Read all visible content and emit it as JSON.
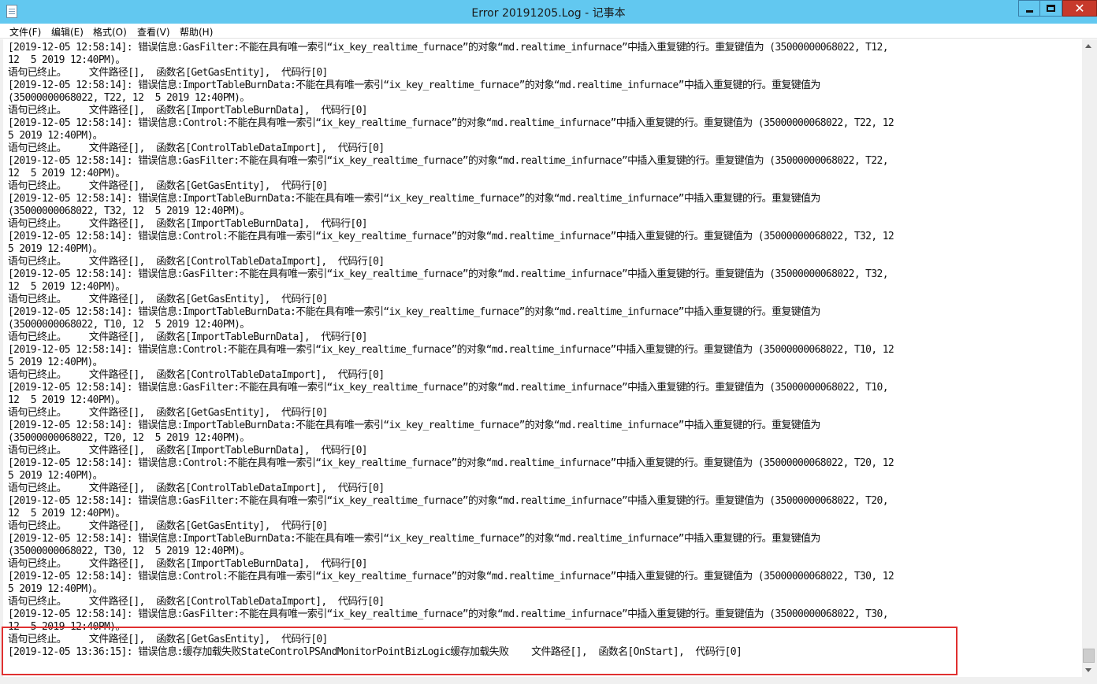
{
  "window": {
    "title": "Error 20191205.Log - 记事本"
  },
  "menu": [
    "文件(F)",
    "编辑(E)",
    "格式(O)",
    "查看(V)",
    "帮助(H)"
  ],
  "log_lines": [
    "[2019-12-05 12:58:14]: 错误信息:GasFilter:不能在具有唯一索引“ix_key_realtime_furnace”的对象“md.realtime_infurnace”中插入重复键的行。重复键值为 (35000000068022, T12,",
    "12  5 2019 12:40PM)。",
    "语句已终止。    文件路径[],  函数名[GetGasEntity],  代码行[0]",
    "[2019-12-05 12:58:14]: 错误信息:ImportTableBurnData:不能在具有唯一索引“ix_key_realtime_furnace”的对象“md.realtime_infurnace”中插入重复键的行。重复键值为",
    "(35000000068022, T22, 12  5 2019 12:40PM)。",
    "语句已终止。    文件路径[],  函数名[ImportTableBurnData],  代码行[0]",
    "[2019-12-05 12:58:14]: 错误信息:Control:不能在具有唯一索引“ix_key_realtime_furnace”的对象“md.realtime_infurnace”中插入重复键的行。重复键值为 (35000000068022, T22, 12",
    "5 2019 12:40PM)。",
    "语句已终止。    文件路径[],  函数名[ControlTableDataImport],  代码行[0]",
    "[2019-12-05 12:58:14]: 错误信息:GasFilter:不能在具有唯一索引“ix_key_realtime_furnace”的对象“md.realtime_infurnace”中插入重复键的行。重复键值为 (35000000068022, T22,",
    "12  5 2019 12:40PM)。",
    "语句已终止。    文件路径[],  函数名[GetGasEntity],  代码行[0]",
    "[2019-12-05 12:58:14]: 错误信息:ImportTableBurnData:不能在具有唯一索引“ix_key_realtime_furnace”的对象“md.realtime_infurnace”中插入重复键的行。重复键值为",
    "(35000000068022, T32, 12  5 2019 12:40PM)。",
    "语句已终止。    文件路径[],  函数名[ImportTableBurnData],  代码行[0]",
    "[2019-12-05 12:58:14]: 错误信息:Control:不能在具有唯一索引“ix_key_realtime_furnace”的对象“md.realtime_infurnace”中插入重复键的行。重复键值为 (35000000068022, T32, 12",
    "5 2019 12:40PM)。",
    "语句已终止。    文件路径[],  函数名[ControlTableDataImport],  代码行[0]",
    "[2019-12-05 12:58:14]: 错误信息:GasFilter:不能在具有唯一索引“ix_key_realtime_furnace”的对象“md.realtime_infurnace”中插入重复键的行。重复键值为 (35000000068022, T32,",
    "12  5 2019 12:40PM)。",
    "语句已终止。    文件路径[],  函数名[GetGasEntity],  代码行[0]",
    "[2019-12-05 12:58:14]: 错误信息:ImportTableBurnData:不能在具有唯一索引“ix_key_realtime_furnace”的对象“md.realtime_infurnace”中插入重复键的行。重复键值为",
    "(35000000068022, T10, 12  5 2019 12:40PM)。",
    "语句已终止。    文件路径[],  函数名[ImportTableBurnData],  代码行[0]",
    "[2019-12-05 12:58:14]: 错误信息:Control:不能在具有唯一索引“ix_key_realtime_furnace”的对象“md.realtime_infurnace”中插入重复键的行。重复键值为 (35000000068022, T10, 12",
    "5 2019 12:40PM)。",
    "语句已终止。    文件路径[],  函数名[ControlTableDataImport],  代码行[0]",
    "[2019-12-05 12:58:14]: 错误信息:GasFilter:不能在具有唯一索引“ix_key_realtime_furnace”的对象“md.realtime_infurnace”中插入重复键的行。重复键值为 (35000000068022, T10,",
    "12  5 2019 12:40PM)。",
    "语句已终止。    文件路径[],  函数名[GetGasEntity],  代码行[0]",
    "[2019-12-05 12:58:14]: 错误信息:ImportTableBurnData:不能在具有唯一索引“ix_key_realtime_furnace”的对象“md.realtime_infurnace”中插入重复键的行。重复键值为",
    "(35000000068022, T20, 12  5 2019 12:40PM)。",
    "语句已终止。    文件路径[],  函数名[ImportTableBurnData],  代码行[0]",
    "[2019-12-05 12:58:14]: 错误信息:Control:不能在具有唯一索引“ix_key_realtime_furnace”的对象“md.realtime_infurnace”中插入重复键的行。重复键值为 (35000000068022, T20, 12",
    "5 2019 12:40PM)。",
    "语句已终止。    文件路径[],  函数名[ControlTableDataImport],  代码行[0]",
    "[2019-12-05 12:58:14]: 错误信息:GasFilter:不能在具有唯一索引“ix_key_realtime_furnace”的对象“md.realtime_infurnace”中插入重复键的行。重复键值为 (35000000068022, T20,",
    "12  5 2019 12:40PM)。",
    "语句已终止。    文件路径[],  函数名[GetGasEntity],  代码行[0]",
    "[2019-12-05 12:58:14]: 错误信息:ImportTableBurnData:不能在具有唯一索引“ix_key_realtime_furnace”的对象“md.realtime_infurnace”中插入重复键的行。重复键值为",
    "(35000000068022, T30, 12  5 2019 12:40PM)。",
    "语句已终止。    文件路径[],  函数名[ImportTableBurnData],  代码行[0]",
    "[2019-12-05 12:58:14]: 错误信息:Control:不能在具有唯一索引“ix_key_realtime_furnace”的对象“md.realtime_infurnace”中插入重复键的行。重复键值为 (35000000068022, T30, 12",
    "5 2019 12:40PM)。",
    "语句已终止。    文件路径[],  函数名[ControlTableDataImport],  代码行[0]",
    "[2019-12-05 12:58:14]: 错误信息:GasFilter:不能在具有唯一索引“ix_key_realtime_furnace”的对象“md.realtime_infurnace”中插入重复键的行。重复键值为 (35000000068022, T30,",
    "12  5 2019 12:40PM)。",
    "语句已终止。    文件路径[],  函数名[GetGasEntity],  代码行[0]",
    "[2019-12-05 13:36:15]: 错误信息:缓存加载失败StateControlPSAndMonitorPointBizLogic缓存加载失败    文件路径[],  函数名[OnStart],  代码行[0]"
  ],
  "colors": {
    "titlebar": "#62c8f0",
    "close_button": "#c7392b",
    "highlight_border": "#e03030"
  }
}
